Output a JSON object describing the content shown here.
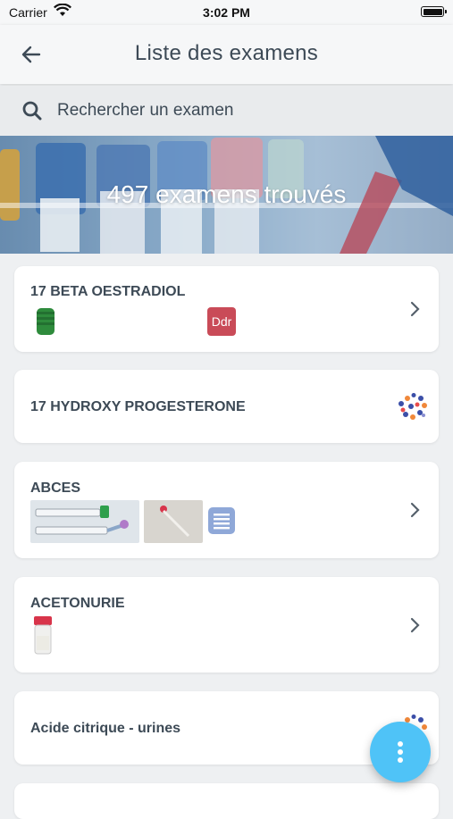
{
  "status_bar": {
    "carrier": "Carrier",
    "time": "3:02 PM"
  },
  "header": {
    "title": "Liste des examens"
  },
  "search": {
    "placeholder": "Rechercher un examen"
  },
  "banner": {
    "count_text": "497 examens trouvés"
  },
  "exams": [
    {
      "name": "17 BETA OESTRADIOL",
      "badge": "Ddr"
    },
    {
      "name": "17 HYDROXY PROGESTERONE"
    },
    {
      "name": "ABCES"
    },
    {
      "name": "ACETONURIE"
    },
    {
      "name": "Acide citrique - urines"
    }
  ],
  "colors": {
    "fab": "#4fc3f7",
    "badge": "#c94b58",
    "tube_green": "#2e8b3c"
  }
}
